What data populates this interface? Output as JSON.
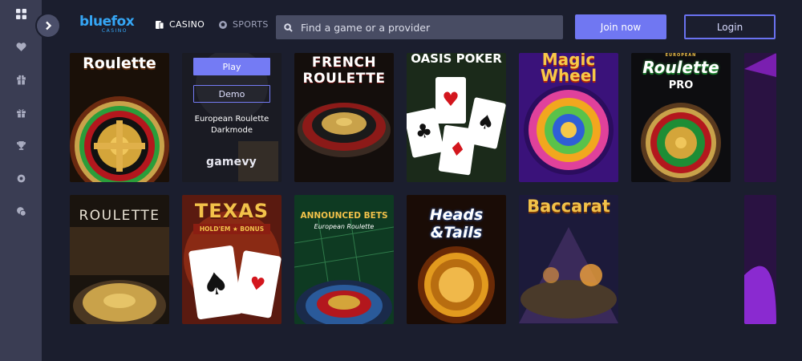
{
  "brand": {
    "name": "bluefox",
    "tagline": "CASINO"
  },
  "nav": {
    "casino": "CASINO",
    "sports": "SPORTS"
  },
  "search": {
    "placeholder": "Find a game or a provider"
  },
  "auth": {
    "join": "Join now",
    "login": "Login"
  },
  "sidebar": {
    "items": [
      {
        "icon": "grid-icon"
      },
      {
        "icon": "heart-icon"
      },
      {
        "icon": "gift-box-icon"
      },
      {
        "icon": "gift-icon"
      },
      {
        "icon": "trophy-icon"
      },
      {
        "icon": "settings-icon"
      },
      {
        "icon": "chat-icon"
      }
    ]
  },
  "games": {
    "row1": [
      {
        "title": "Roulette"
      },
      {
        "title": "European Roulette Darkmode",
        "play": "Play",
        "demo": "Demo",
        "provider": "gamevy"
      },
      {
        "title": "FRENCH ROULETTE",
        "top": "FRENCH"
      },
      {
        "title": "OASIS POKER"
      },
      {
        "title_line1": "Magic",
        "title_line2": "Wheel"
      },
      {
        "title_line1": "EUROPEAN",
        "title_line2": "Roulette",
        "title_line3": "PRO"
      }
    ],
    "row2": [
      {
        "title": "ROULETTE"
      },
      {
        "title": "TEXAS",
        "subtitle": "HOLD'EM ★ BONUS"
      },
      {
        "title": "ANNOUNCED BETS",
        "subtitle": "European Roulette"
      },
      {
        "title_line1": "Heads",
        "title_line2": "&Tails"
      },
      {
        "title": "Baccarat"
      }
    ]
  }
}
